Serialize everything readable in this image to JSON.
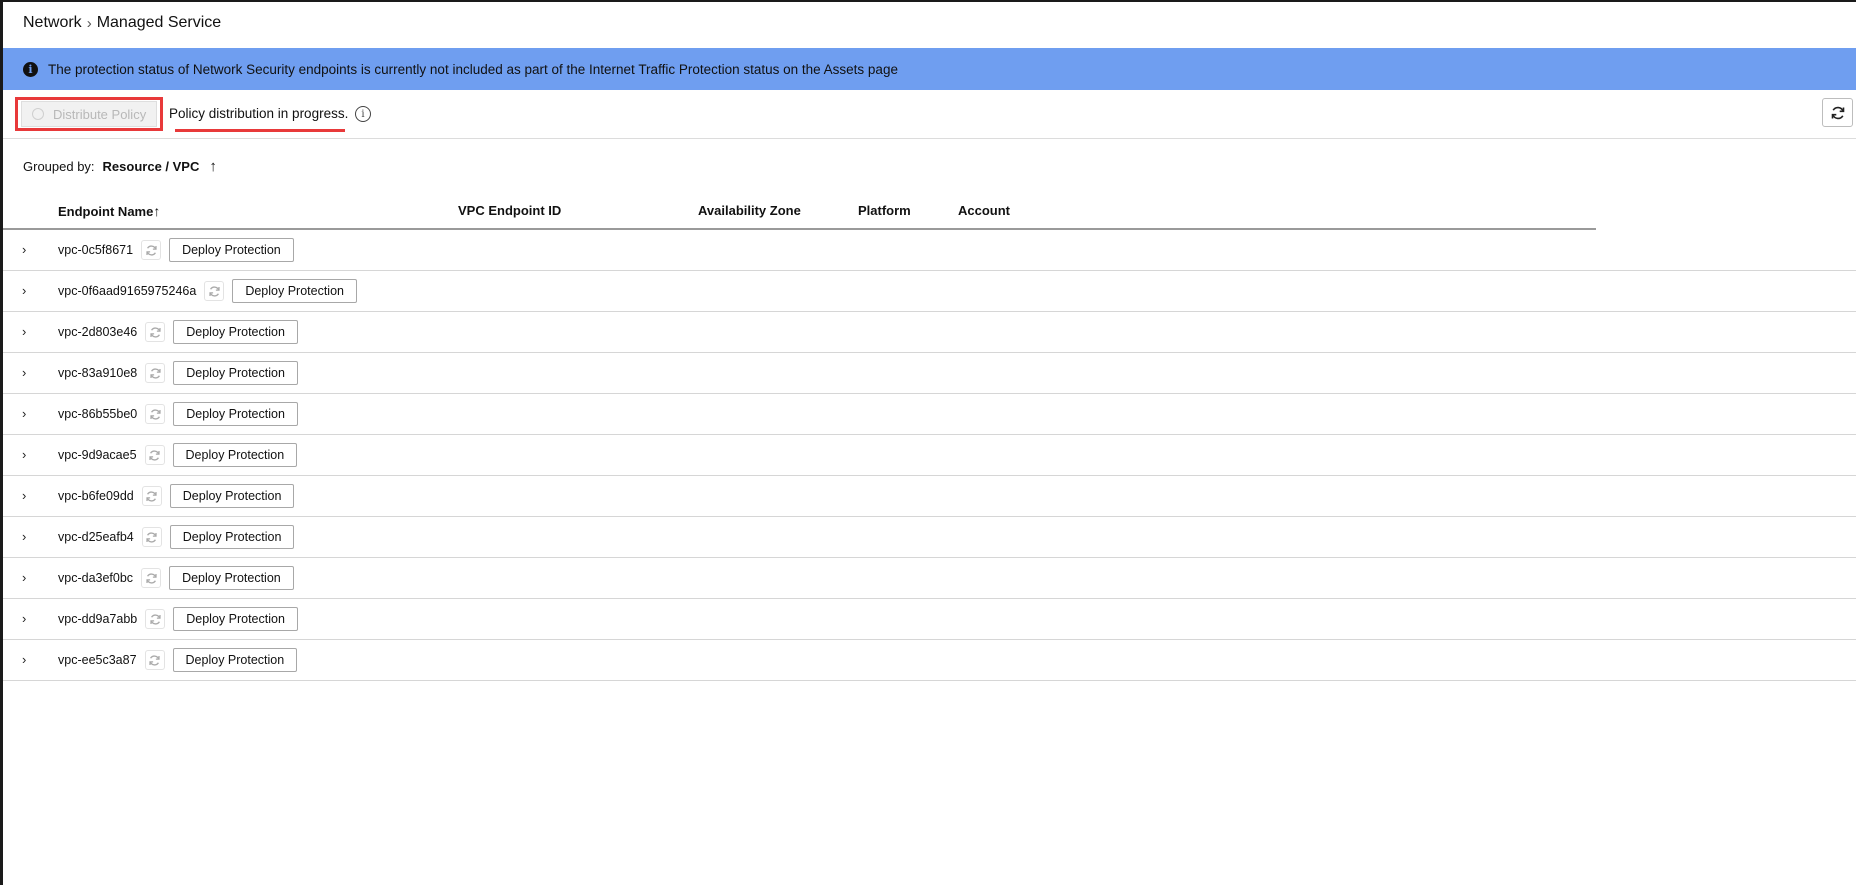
{
  "breadcrumb": {
    "parent": "Network",
    "separator": "›",
    "current": "Managed Service"
  },
  "banner": {
    "text": "The protection status of Network Security endpoints is currently not included as part of the Internet Traffic Protection status on the Assets page",
    "color": "#6f9ef0"
  },
  "toolbar": {
    "distribute_label": "Distribute Policy",
    "progress_text": "Policy distribution in progress.",
    "highlight_color": "#e8393a"
  },
  "grouping": {
    "label": "Grouped by:",
    "value": "Resource / VPC",
    "sort_arrow": "↑"
  },
  "table": {
    "columns": [
      {
        "label": "Endpoint Name",
        "sort_arrow": "↑"
      },
      {
        "label": "VPC Endpoint ID"
      },
      {
        "label": "Availability Zone"
      },
      {
        "label": "Platform"
      },
      {
        "label": "Account"
      }
    ],
    "action_label": "Deploy Protection",
    "rows": [
      {
        "name": "vpc-0c5f8671"
      },
      {
        "name": "vpc-0f6aad9165975246a"
      },
      {
        "name": "vpc-2d803e46"
      },
      {
        "name": "vpc-83a910e8"
      },
      {
        "name": "vpc-86b55be0"
      },
      {
        "name": "vpc-9d9acae5"
      },
      {
        "name": "vpc-b6fe09dd"
      },
      {
        "name": "vpc-d25eafb4"
      },
      {
        "name": "vpc-da3ef0bc"
      },
      {
        "name": "vpc-dd9a7abb"
      },
      {
        "name": "vpc-ee5c3a87"
      }
    ]
  }
}
